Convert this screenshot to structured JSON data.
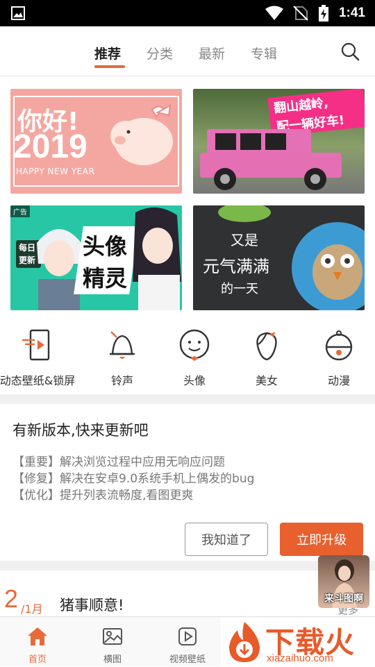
{
  "status_bar": {
    "time": "1:41",
    "icons": [
      "gallery-icon",
      "wifi-icon",
      "no-sim-icon",
      "battery-charging-icon"
    ]
  },
  "top_nav": {
    "tabs": [
      {
        "label": "推荐",
        "active": true
      },
      {
        "label": "分类",
        "active": false
      },
      {
        "label": "最新",
        "active": false
      },
      {
        "label": "专辑",
        "active": false
      }
    ],
    "search_icon": "search-icon"
  },
  "banners": [
    {
      "text_main": "你好!",
      "text_year": "2019",
      "text_sub": "HAPPY NEW YEAR"
    },
    {
      "text_line1": "翻山越岭,",
      "text_line2": "配一辆好车!"
    },
    {
      "tag": "广告",
      "badge_line1": "每日",
      "badge_line2": "更新",
      "text_line1": "头像",
      "text_line2": "精灵"
    },
    {
      "text_line1": "又是",
      "text_line2": "元气满满",
      "text_line3": "的一天"
    }
  ],
  "shortcuts": [
    {
      "label": "动态壁纸&锁屏",
      "icon": "live-wallpaper-icon"
    },
    {
      "label": "铃声",
      "icon": "bell-icon"
    },
    {
      "label": "头像",
      "icon": "face-icon"
    },
    {
      "label": "美女",
      "icon": "girl-icon"
    },
    {
      "label": "动漫",
      "icon": "anime-icon"
    }
  ],
  "update": {
    "title": "有新版本,快来更新吧",
    "lines": [
      "【重要】解决浏览过程中应用无响应问题",
      "【修复】解决在安卓9.0系统手机上偶发的bug",
      "【优化】提升列表流畅度,看图更爽"
    ],
    "later_label": "我知道了",
    "upgrade_label": "立即升级"
  },
  "daily": {
    "day": "2",
    "month": "/1月",
    "title": "猪事顺意!",
    "more": "更多"
  },
  "bottom_nav": [
    {
      "label": "首页",
      "icon": "home-icon",
      "active": true
    },
    {
      "label": "横图",
      "icon": "image-icon",
      "active": false
    },
    {
      "label": "视频壁纸",
      "icon": "video-icon",
      "active": false
    }
  ],
  "floating_ad": {
    "caption": "来斗图啊"
  },
  "watermark": {
    "text": "下载火",
    "url": "xiazaihuo.com"
  },
  "colors": {
    "accent": "#e86a3a",
    "upgrade_button": "#e8602e"
  }
}
